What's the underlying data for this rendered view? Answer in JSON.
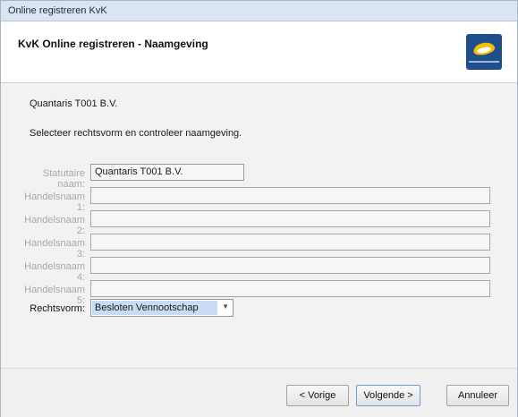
{
  "window": {
    "title": "Online registreren KvK"
  },
  "header": {
    "title": "KvK Online registreren - Naamgeving"
  },
  "content": {
    "company_name": "Quantaris T001 B.V.",
    "instruction": "Selecteer rechtsvorm en controleer naamgeving.",
    "fields": [
      {
        "label": "Statutaire naam:",
        "value": "Quantaris T001 B.V."
      },
      {
        "label": "Handelsnaam 1:",
        "value": ""
      },
      {
        "label": "Handelsnaam 2:",
        "value": ""
      },
      {
        "label": "Handelsnaam 3:",
        "value": ""
      },
      {
        "label": "Handelsnaam 4:",
        "value": ""
      },
      {
        "label": "Handelsnaam 5:",
        "value": ""
      }
    ],
    "rechtsvorm": {
      "label": "Rechtsvorm:",
      "selected": "Besloten Vennootschap"
    }
  },
  "footer": {
    "back_label": "< Vorige",
    "next_label": "Volgende >",
    "cancel_label": "Annuleer"
  },
  "icons": {
    "logo": "kvk-logo-icon",
    "dropdown": "chevron-down-icon"
  }
}
